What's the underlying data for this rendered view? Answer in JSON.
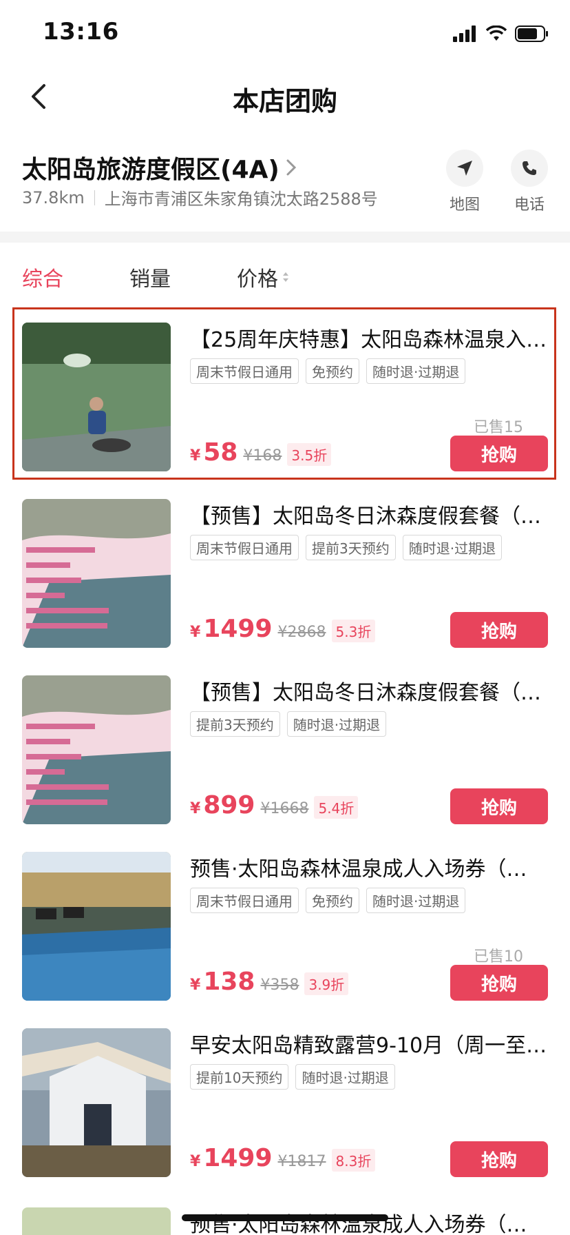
{
  "status_bar": {
    "time": "13:16"
  },
  "nav": {
    "title": "本店团购"
  },
  "shop": {
    "name": "太阳岛旅游度假区(4A)",
    "distance": "37.8km",
    "address": "上海市青浦区朱家角镇沈太路2588号",
    "map_label": "地图",
    "phone_label": "电话"
  },
  "sort": {
    "comprehensive": "综合",
    "sales": "销量",
    "price": "价格"
  },
  "currency": "¥",
  "buy_label": "抢购",
  "deals": [
    {
      "title": "【25周年庆特惠】太阳岛森林温泉入…",
      "tags": [
        "周末节假日通用",
        "免预约",
        "随时退·过期退"
      ],
      "price": "58",
      "orig": "¥168",
      "disc": "3.5折",
      "sold": "已售15"
    },
    {
      "title": "【预售】太阳岛冬日沐森度假套餐（…",
      "tags": [
        "周末节假日通用",
        "提前3天预约",
        "随时退·过期退"
      ],
      "price": "1499",
      "orig": "¥2868",
      "disc": "5.3折",
      "sold": ""
    },
    {
      "title": "【预售】太阳岛冬日沐森度假套餐（…",
      "tags": [
        "提前3天预约",
        "随时退·过期退"
      ],
      "price": "899",
      "orig": "¥1668",
      "disc": "5.4折",
      "sold": ""
    },
    {
      "title": "预售·太阳岛森林温泉成人入场券（…",
      "tags": [
        "周末节假日通用",
        "免预约",
        "随时退·过期退"
      ],
      "price": "138",
      "orig": "¥358",
      "disc": "3.9折",
      "sold": "已售10"
    },
    {
      "title": "早安太阳岛精致露营9-10月（周一至…",
      "tags": [
        "提前10天预约",
        "随时退·过期退"
      ],
      "price": "1499",
      "orig": "¥1817",
      "disc": "8.3折",
      "sold": ""
    }
  ],
  "partial_deal": {
    "title": "预售·太阳岛森林温泉成人入场券（…"
  }
}
